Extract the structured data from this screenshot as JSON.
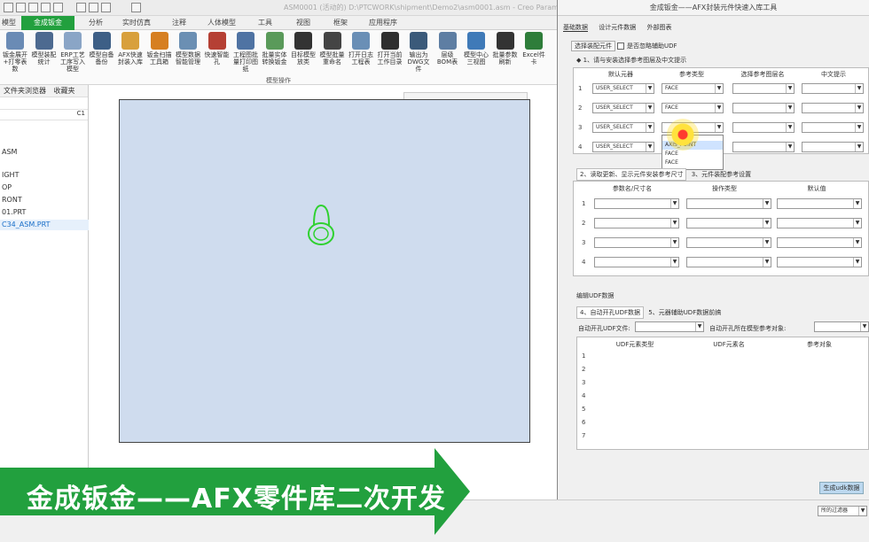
{
  "window": {
    "title": "ASM0001 (活动的) D:\\PTCWORK\\shipment\\Demo2\\asm0001.asm - Creo Parametric"
  },
  "tabs": [
    "模型",
    "金成钣金",
    "分析",
    "实时仿真",
    "注释",
    "人体模型",
    "工具",
    "视图",
    "框架",
    "应用程序"
  ],
  "active_tab": "金成钣金",
  "ribbon": {
    "buttons": [
      {
        "label": "钣金展开+打零表数",
        "color": "#6a8bb5"
      },
      {
        "label": "模型装配统计",
        "color": "#4d6a90"
      },
      {
        "label": "ERP工艺工序写入模型",
        "color": "#8aa5c6"
      },
      {
        "label": "模型自备备份",
        "color": "#3d5f86"
      },
      {
        "label": "AFX快速封装入库",
        "color": "#d8a03c"
      },
      {
        "label": "钣金扫描工具箱",
        "color": "#d67f21"
      },
      {
        "label": "模型数据智能管理",
        "color": "#6b8fb3"
      },
      {
        "label": "快速智能孔",
        "color": "#b54034"
      },
      {
        "label": "工程图批量打印图纸",
        "color": "#4f73a3"
      },
      {
        "label": "批量实体转换钣金",
        "color": "#5a9a5a"
      },
      {
        "label": "目标模型放类",
        "color": "#333333"
      },
      {
        "label": "模型批量重命名",
        "color": "#444444"
      },
      {
        "label": "打开日志工程表",
        "color": "#6a8fb6"
      },
      {
        "label": "打开当前工作目录",
        "color": "#2f2f2f"
      },
      {
        "label": "输出为DWG文件",
        "color": "#3b5a7a"
      },
      {
        "label": "层级BOM表",
        "color": "#5e7ea3"
      },
      {
        "label": "模型中心三视图",
        "color": "#3f7ab8"
      },
      {
        "label": "批量参数刷新",
        "color": "#333333"
      },
      {
        "label": "Excel件卡",
        "color": "#2e7d3a"
      }
    ],
    "group_label": "模型操作"
  },
  "left_panel": {
    "tabs": [
      "文件夹浏览器",
      "收藏夹"
    ],
    "column": "C1",
    "tree": [
      "ASM",
      "",
      "IGHT",
      "OP",
      "RONT",
      "01.PRT",
      "C34_ASM.PRT"
    ]
  },
  "dialog": {
    "title": "金成钣金——AFX封装元件快速入库工具",
    "tabs": [
      "基础数据",
      "设计元件数据",
      "外部图表"
    ],
    "select_button": "选择装配元件",
    "checkbox_label": "是否忽略辅助UDF",
    "section1": {
      "title": "1、请与安装选择参考图层及中文提示",
      "headers": [
        "默认元器",
        "参考类型",
        "选择参考图层名",
        "中文提示"
      ],
      "rows": [
        {
          "n": "1",
          "a": "USER_SELECT",
          "b": "FACE"
        },
        {
          "n": "2",
          "a": "USER_SELECT",
          "b": "FACE"
        },
        {
          "n": "3",
          "a": "USER_SELECT",
          "b": ""
        },
        {
          "n": "4",
          "a": "USER_SELECT",
          "b": ""
        }
      ],
      "dropdown_options": [
        "AXIS_POINT",
        "FACE",
        "FACE"
      ]
    },
    "section2": {
      "tab1": "2、读取更新、显示元件安装参考尺寸",
      "tab2": "3、元件装配参考设置",
      "headers": [
        "参数名/尺寸名",
        "操作类型",
        "默认值"
      ],
      "rows": [
        "1",
        "2",
        "3",
        "4"
      ]
    },
    "section3": {
      "group": "编辑UDF数据",
      "tab1": "4、自动开孔UDF数据",
      "tab2": "5、元器辅助UDF数据前搞",
      "udf_file_label": "自动开孔UDF文件:",
      "ref_label": "自动开孔所在模型参考对象:",
      "headers": [
        "UDF元素类型",
        "UDF元素名",
        "参考对象"
      ],
      "rows": [
        "1",
        "2",
        "3",
        "4",
        "5",
        "6",
        "7"
      ]
    },
    "finish_button": "生成udk数据"
  },
  "banner": {
    "text": "金成钣金——AFX零件库二次开发",
    "color": "#22a03e"
  },
  "status": {
    "filter": "所的过滤器"
  }
}
